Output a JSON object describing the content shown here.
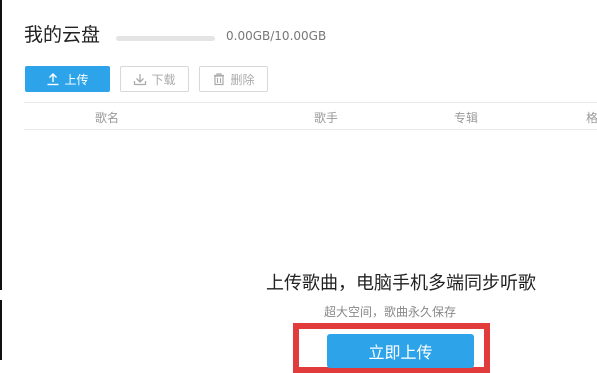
{
  "page": {
    "title": "我的云盘",
    "capacity": {
      "used": "0.00GB",
      "total": "10.00GB",
      "text": "0.00GB/10.00GB",
      "fraction_used": 0.0
    }
  },
  "toolbar": {
    "upload_label": "上传",
    "download_label": "下载",
    "delete_label": "删除"
  },
  "table": {
    "columns": [
      "歌名",
      "歌手",
      "专辑",
      "格"
    ]
  },
  "empty_state": {
    "title": "上传歌曲，电脑手机多端同步听歌",
    "subtitle": "超大空间，歌曲永久保存",
    "button_label": "立即上传"
  },
  "colors": {
    "accent": "#2da4ea",
    "highlight": "#e23b3b"
  },
  "icons": {
    "upload": "upload-icon",
    "download": "download-icon",
    "delete": "trash-icon"
  }
}
